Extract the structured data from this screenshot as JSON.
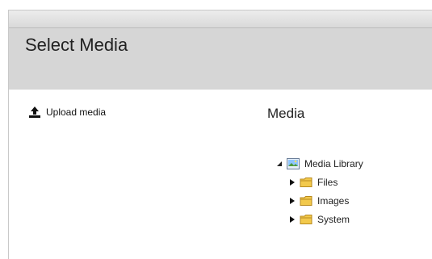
{
  "dialog": {
    "title": "Select Media"
  },
  "upload": {
    "label": "Upload media",
    "icon": "upload-icon"
  },
  "media_panel": {
    "title": "Media",
    "tree": {
      "root": {
        "label": "Media Library",
        "expanded": true,
        "icon": "media-library-icon"
      },
      "children": [
        {
          "label": "Files",
          "expanded": false,
          "icon": "folder-icon"
        },
        {
          "label": "Images",
          "expanded": false,
          "icon": "folder-icon"
        },
        {
          "label": "System",
          "expanded": false,
          "icon": "folder-icon"
        }
      ]
    }
  },
  "colors": {
    "header_bg": "#d6d6d6",
    "folder_yellow": "#f2c94c"
  }
}
